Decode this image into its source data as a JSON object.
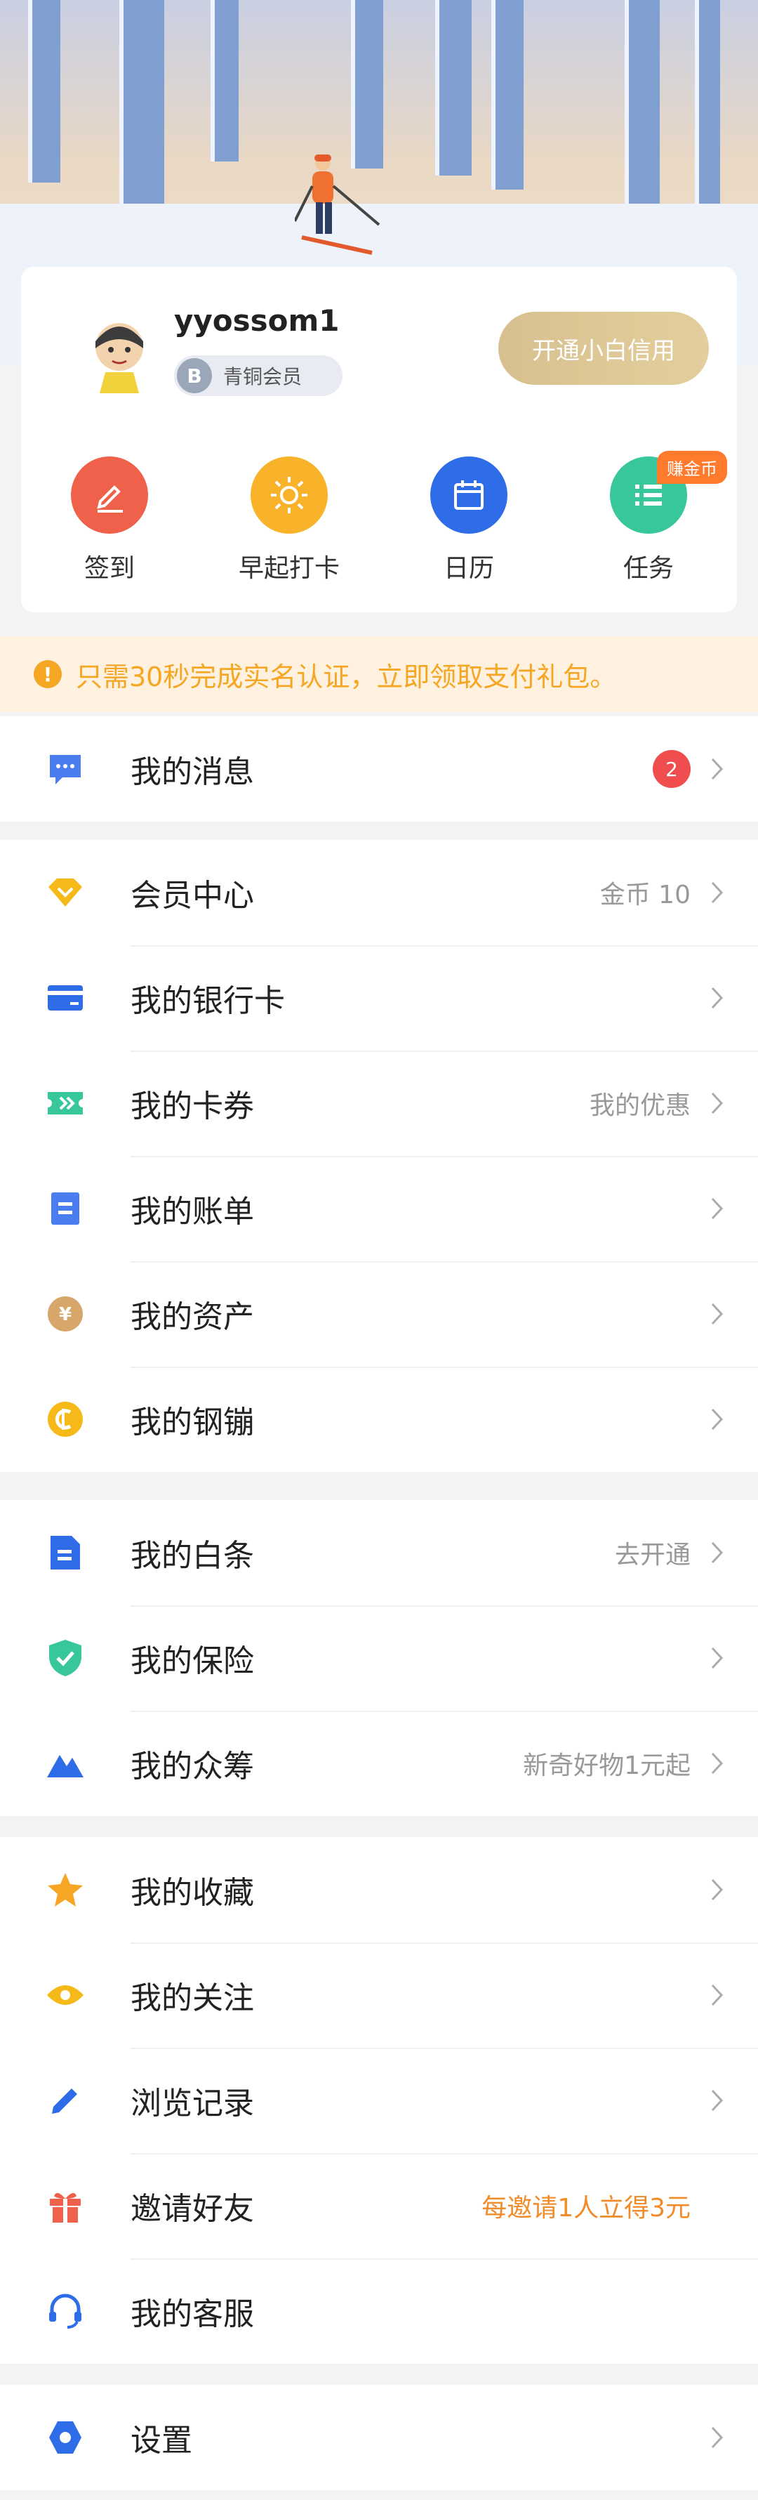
{
  "profile": {
    "username": "yyossom1",
    "badge_letter": "B",
    "badge_label": "青铜会员",
    "open_credit": "开通小白信用"
  },
  "quick_actions": [
    {
      "label": "签到",
      "color": "#f0614b",
      "icon": "pen-icon"
    },
    {
      "label": "早起打卡",
      "color": "#f9b32a",
      "icon": "sun-icon"
    },
    {
      "label": "日历",
      "color": "#2f6de8",
      "icon": "calendar-icon"
    },
    {
      "label": "任务",
      "color": "#37c79a",
      "icon": "list-icon"
    }
  ],
  "task_tag": "赚金币",
  "notice": {
    "icon": "!",
    "text": "只需30秒完成实名认证，立即领取支付礼包。"
  },
  "menu": {
    "messages": {
      "label": "我的消息",
      "count": "2"
    },
    "member_center": {
      "label": "会员中心",
      "sub": "金币 10"
    },
    "bank_card": {
      "label": "我的银行卡"
    },
    "coupons": {
      "label": "我的卡券",
      "sub": "我的优惠"
    },
    "bills": {
      "label": "我的账单"
    },
    "assets": {
      "label": "我的资产"
    },
    "steel": {
      "label": "我的钢镚"
    },
    "baitiao": {
      "label": "我的白条",
      "sub": "去开通"
    },
    "insurance": {
      "label": "我的保险"
    },
    "crowdfunding": {
      "label": "我的众筹",
      "sub": "新奇好物1元起"
    },
    "favorites": {
      "label": "我的收藏"
    },
    "follows": {
      "label": "我的关注"
    },
    "history": {
      "label": "浏览记录"
    },
    "invite": {
      "label": "邀请好友",
      "sub": "每邀请1人立得3元"
    },
    "service": {
      "label": "我的客服"
    },
    "settings": {
      "label": "设置"
    }
  },
  "colors": {
    "accent_blue": "#2f6de8",
    "gold": "#d7c08f",
    "warn": "#f5a623",
    "red_dot": "#f04e4e"
  }
}
